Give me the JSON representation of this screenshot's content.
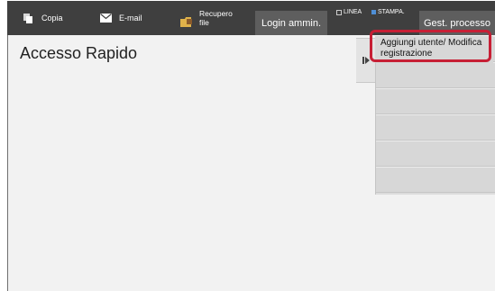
{
  "topbar": {
    "copy_label": "Copia",
    "email_label": "E-mail",
    "file_label": "Recupero file",
    "login_label": "Login ammin.",
    "status_line_label": "LINEA",
    "status_print_label": "STAMPA.",
    "gest_label": "Gest. processo"
  },
  "main": {
    "title": "Accesso Rapido"
  },
  "sidebar": {
    "items": [
      {
        "label": "Aggiungi utente/ Modifica registrazione"
      },
      {
        "label": ""
      },
      {
        "label": ""
      },
      {
        "label": ""
      },
      {
        "label": ""
      },
      {
        "label": ""
      }
    ]
  },
  "icons": {
    "copy": "copy-icon",
    "email": "envelope-icon",
    "file": "folder-retrieve-icon",
    "collapse": "collapse-panel-icon"
  },
  "colors": {
    "topbar_bg": "#3f3f3f",
    "button_bg": "#5e5e5e",
    "highlight_border": "#c71f35",
    "print_status": "#4f8fd6"
  }
}
